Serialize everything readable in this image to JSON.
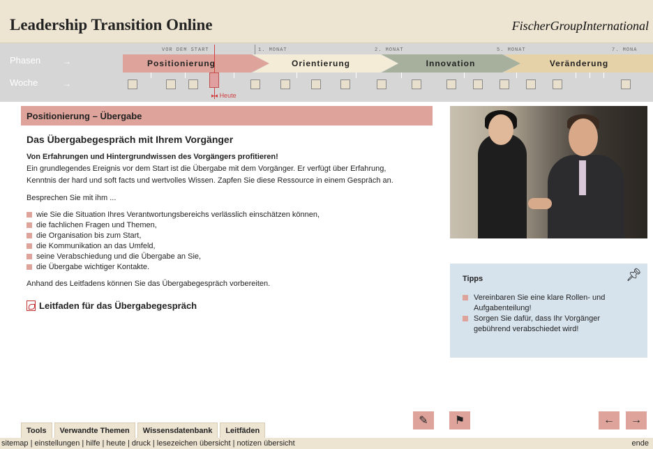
{
  "header": {
    "title": "Leadership Transition Online",
    "brand": "FischerGroupInternational"
  },
  "timeline": {
    "row_labels": {
      "phases": "Phasen",
      "weeks": "Woche"
    },
    "months": [
      "VOR DEM START",
      "1. MONAT",
      "2. MONAT",
      "5. MONAT",
      "7. MONA"
    ],
    "phases": [
      {
        "label": "Positionierung",
        "color": "#dea49c"
      },
      {
        "label": "Orientierung",
        "color": "#f4ecd6"
      },
      {
        "label": "Innovation",
        "color": "#a6b09c"
      },
      {
        "label": "Veränderung",
        "color": "#e6d2a8"
      }
    ],
    "today_label": "Heute"
  },
  "section": {
    "title": "Positionierung – Übergabe"
  },
  "article": {
    "heading": "Das Übergabegespräch mit Ihrem Vorgänger",
    "subheading": "Von Erfahrungen und Hintergrundwissen des Vorgängers profitieren!",
    "intro": "Ein grundlegendes Ereignis vor dem Start ist die Übergabe mit dem Vorgänger. Er verfügt über Erfahrung, Kenntnis der hard und soft facts und wertvolles Wissen. Zapfen Sie diese Ressource in einem Gespräch an.",
    "lead": "Besprechen Sie mit ihm ...",
    "bullets": [
      "wie Sie die Situation Ihres Verantwortungsbereichs verlässlich einschätzen können,",
      "die fachlichen Fragen und Themen,",
      "die Organisation bis zum Start,",
      "die Kommunikation an das Umfeld,",
      "seine Verabschiedung und die Übergabe an Sie,",
      "die Übergabe wichtiger Kontakte."
    ],
    "closing": "Anhand des Leitfadens können Sie das Übergabegespräch vorbereiten.",
    "pdf_link": "Leitfaden für das Übergabegespräch"
  },
  "tips": {
    "title": "Tipps",
    "items": [
      "Vereinbaren Sie eine klare Rollen- und Aufgabenteilung!",
      "Sorgen Sie dafür, dass Ihr Vorgänger gebührend verabschiedet wird!"
    ]
  },
  "tabs": [
    "Tools",
    "Verwandte Themen",
    "Wissensdatenbank",
    "Leitfäden"
  ],
  "footer": {
    "links": "sitemap | einstellungen | hilfe | heute | druck | lesezeichen übersicht | notizen übersicht",
    "end": "ende"
  },
  "colors": {
    "accent": "#dea49c",
    "header_bg": "#ede4d2",
    "timeline_bg": "#d6d6d6",
    "tips_bg": "#d6e2ec",
    "today": "#d04040"
  },
  "icons": [
    "notes-icon",
    "bookmark-icon",
    "arrow-left-icon",
    "arrow-right-icon",
    "pin-icon",
    "pdf-icon"
  ]
}
